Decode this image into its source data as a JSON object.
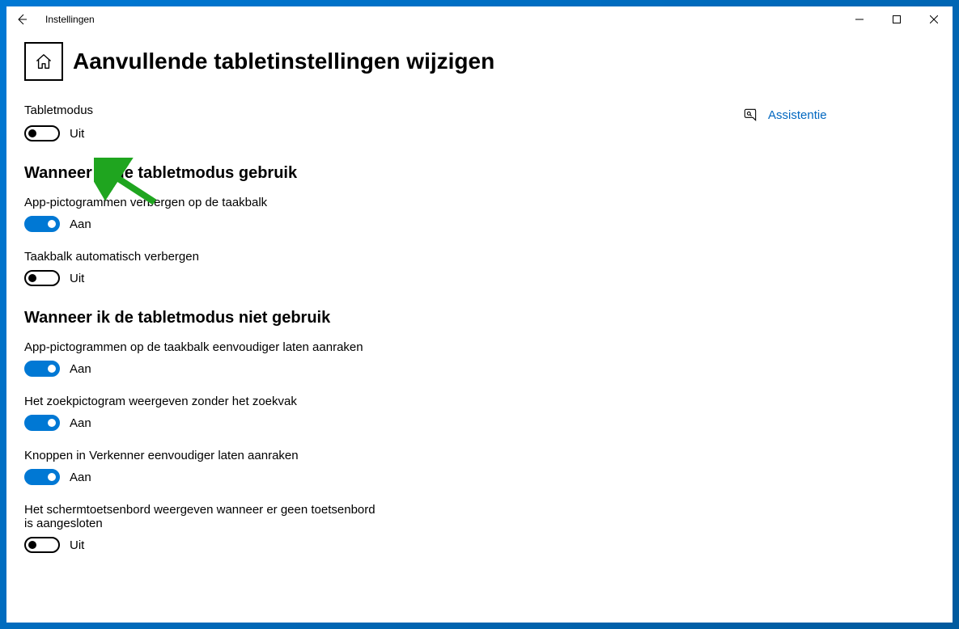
{
  "window": {
    "title": "Instellingen"
  },
  "page": {
    "title": "Aanvullende tabletinstellingen wijzigen"
  },
  "tabletmode": {
    "label": "Tabletmodus",
    "state_label": "Uit",
    "on": false
  },
  "section_using": {
    "heading": "Wanneer ik de tabletmodus gebruik",
    "items": [
      {
        "desc": "App-pictogrammen verbergen op de taakbalk",
        "state_label": "Aan",
        "on": true
      },
      {
        "desc": "Taakbalk automatisch verbergen",
        "state_label": "Uit",
        "on": false
      }
    ]
  },
  "section_not_using": {
    "heading": "Wanneer ik de tabletmodus niet gebruik",
    "items": [
      {
        "desc": "App-pictogrammen op de taakbalk eenvoudiger laten aanraken",
        "state_label": "Aan",
        "on": true
      },
      {
        "desc": "Het zoekpictogram weergeven zonder het zoekvak",
        "state_label": "Aan",
        "on": true
      },
      {
        "desc": "Knoppen in Verkenner eenvoudiger laten aanraken",
        "state_label": "Aan",
        "on": true
      },
      {
        "desc": "Het schermtoetsenbord weergeven wanneer er geen toetsenbord is aangesloten",
        "state_label": "Uit",
        "on": false
      }
    ]
  },
  "assist": {
    "label": "Assistentie"
  }
}
